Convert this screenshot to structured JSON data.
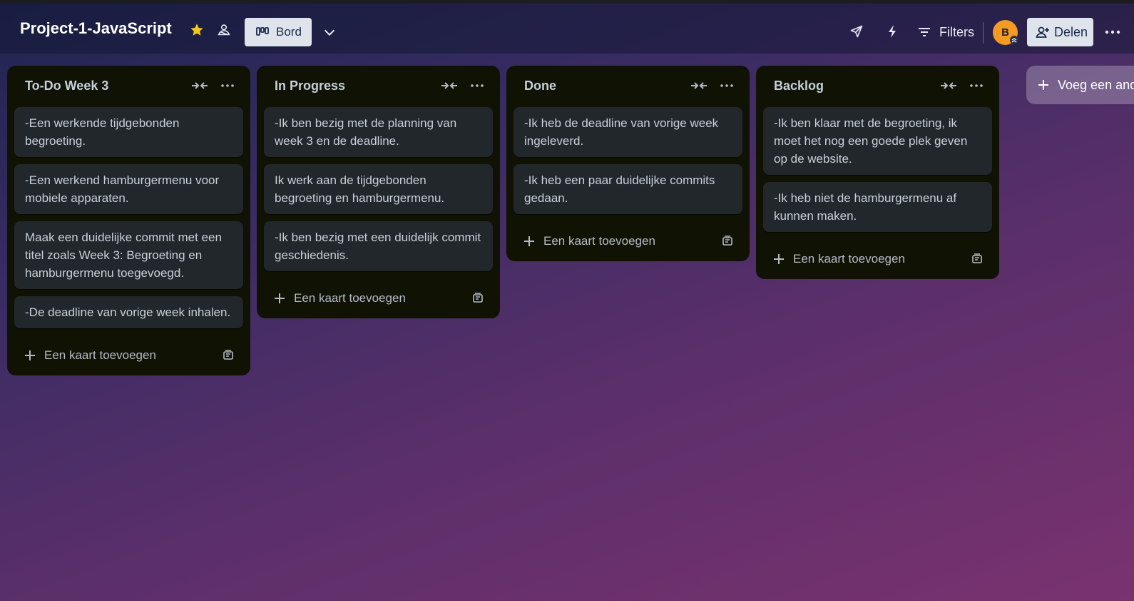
{
  "board": {
    "title": "Project-1-JavaScript",
    "view_label": "Bord",
    "filters_label": "Filters",
    "share_label": "Delen",
    "avatar_initial": "B",
    "add_list_label": "Voeg een ande"
  },
  "lists": [
    {
      "title": "To-Do Week 3",
      "cards": [
        "-Een werkende tijdgebonden begroeting.",
        "-Een werkend hamburgermenu voor mobiele apparaten.",
        "Maak een duidelijke commit met een titel zoals Week 3: Begroeting en hamburgermenu toegevoegd.",
        "-De deadline van vorige week inhalen."
      ],
      "add_card_label": "Een kaart toevoegen"
    },
    {
      "title": "In Progress",
      "cards": [
        "-Ik ben bezig met de planning van week 3 en de deadline.",
        "Ik werk aan de tijdgebonden begroeting en hamburgermenu.",
        "-Ik ben bezig met een duidelijk commit geschiedenis."
      ],
      "add_card_label": "Een kaart toevoegen"
    },
    {
      "title": "Done",
      "cards": [
        "-Ik heb de deadline van vorige week ingeleverd.",
        "-Ik heb een paar duidelijke commits gedaan."
      ],
      "add_card_label": "Een kaart toevoegen"
    },
    {
      "title": "Backlog",
      "cards": [
        "-Ik ben klaar met de begroeting, ik moet het nog een goede plek geven op de website.",
        "-Ik heb niet de hamburgermenu af kunnen maken."
      ],
      "add_card_label": "Een kaart toevoegen"
    }
  ],
  "colors": {
    "list_bg": "#101204",
    "card_bg": "#22272b",
    "star": "#f5c518",
    "avatar": "#f59a23",
    "button_bg": "#dfe4ec"
  },
  "icons": {
    "star": "star-icon",
    "visibility": "workspace-visible-icon",
    "view": "board-view-icon",
    "chevron": "chevron-down-icon",
    "power_ups": "send-icon",
    "automation": "lightning-icon",
    "filters": "filter-icon",
    "share": "add-person-icon",
    "menu": "more-icon",
    "collapse": "collapse-list-icon",
    "add": "plus-icon",
    "template": "card-template-icon"
  }
}
